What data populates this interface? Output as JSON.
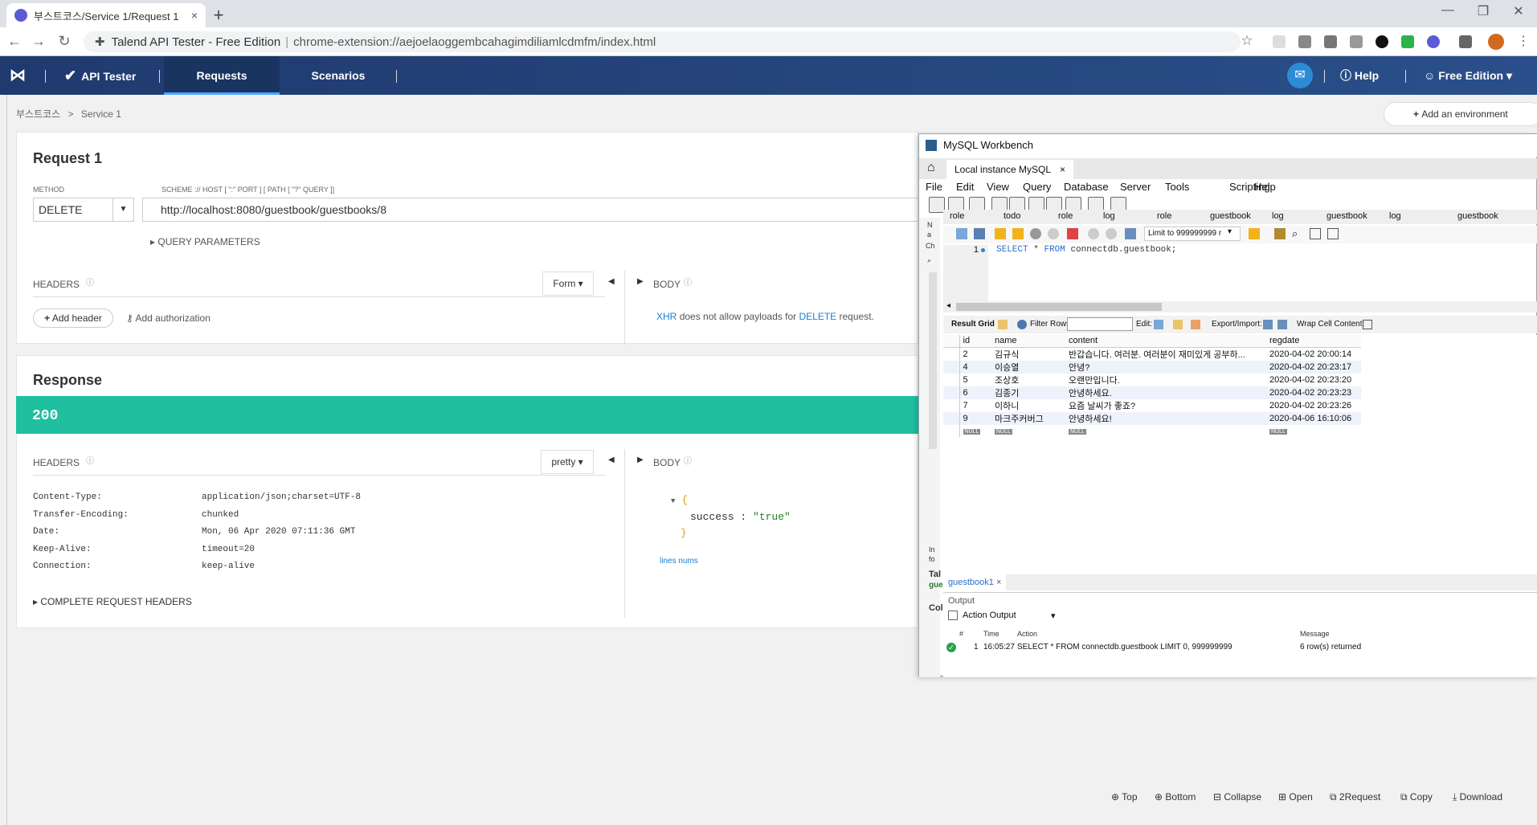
{
  "browser": {
    "tab_title": "부스트코스/Service 1/Request 1",
    "close": "×",
    "newtab": "+",
    "win_min": "—",
    "win_max": "❐",
    "win_close": "✕",
    "back": "←",
    "forward": "→",
    "reload": "↻",
    "ext_title": "Talend API Tester - Free Edition",
    "url": "chrome-extension://aejoelaoggembcahagimdiliamlcdmfm/index.html",
    "star": "☆"
  },
  "app": {
    "brand": "API Tester",
    "tabs": [
      "Requests",
      "Scenarios"
    ],
    "help": "Help",
    "edition": "Free Edition"
  },
  "breadcrumb": {
    "root": "부스트코스",
    "sep": ">",
    "leaf": "Service 1"
  },
  "env_button": "Add an environment",
  "request": {
    "title": "Request 1",
    "method_label": "METHOD",
    "method": "DELETE",
    "scheme_label": "SCHEME :// HOST [ \":\" PORT ] [ PATH [ \"?\" QUERY ]]",
    "url": "http://localhost:8080/guestbook/guestbooks/8",
    "query_params": "QUERY PARAMETERS",
    "headers_label": "HEADERS",
    "form_label": "Form",
    "body_label": "BODY",
    "add_header": "Add header",
    "add_auth": "Add authorization",
    "body_note_xhr": "XHR",
    "body_note_mid": "does not allow payloads for",
    "body_note_method": "DELETE",
    "body_note_end": "request."
  },
  "response": {
    "title": "Response",
    "status": "200",
    "headers_label": "HEADERS",
    "pretty_label": "pretty",
    "body_label": "BODY",
    "headers": [
      {
        "k": "Content-Type:",
        "v": "application/json;charset=UTF-8"
      },
      {
        "k": "Transfer-Encoding:",
        "v": "chunked"
      },
      {
        "k": "Date:",
        "v": "Mon, 06 Apr 2020 07:11:36 GMT"
      },
      {
        "k": "Keep-Alive:",
        "v": "timeout=20"
      },
      {
        "k": "Connection:",
        "v": "keep-alive"
      }
    ],
    "complete_headers": "COMPLETE REQUEST HEADERS",
    "json_open": "{",
    "json_key": "success :",
    "json_val": "\"true\"",
    "json_close": "}",
    "lines_nums": "lines nums"
  },
  "footer": [
    "Top",
    "Bottom",
    "Collapse",
    "Open",
    "2Request",
    "Copy",
    "Download"
  ],
  "workbench": {
    "title": "MySQL Workbench",
    "instance_tab": "Local instance MySQL",
    "menus": [
      "File",
      "Edit",
      "View",
      "Query",
      "Database",
      "Server",
      "Tools",
      "Scripting",
      "Help"
    ],
    "sql_tabs": [
      "role",
      "todo",
      "role",
      "log",
      "role",
      "guestbook",
      "log",
      "guestbook",
      "log",
      "guestbook"
    ],
    "limit": "Limit to 999999999 r",
    "line_no": "1",
    "sql_kw1": "SELECT",
    "sql_star": "*",
    "sql_kw2": "FROM",
    "sql_rest": "connectdb.guestbook;",
    "result_grid": "Result Grid",
    "filter_rows": "Filter Rows:",
    "edit": "Edit:",
    "export": "Export/Import:",
    "wrap": "Wrap Cell Content:",
    "columns": [
      "id",
      "name",
      "content",
      "regdate"
    ],
    "rows": [
      [
        "2",
        "김규식",
        "반갑습니다. 여러분. 여러분이 재미있게 공부하...",
        "2020-04-02 20:00:14"
      ],
      [
        "4",
        "이승열",
        "안녕?",
        "2020-04-02 20:23:17"
      ],
      [
        "5",
        "조상호",
        "오랜만입니다.",
        "2020-04-02 20:23:20"
      ],
      [
        "6",
        "김종기",
        "안녕하세요.",
        "2020-04-02 20:23:23"
      ],
      [
        "7",
        "이하니",
        "요즘 날씨가 좋죠?",
        "2020-04-02 20:23:26"
      ],
      [
        "9",
        "마크주커버그",
        "안녕하세요!",
        "2020-04-06 16:10:06"
      ]
    ],
    "null": "NULL",
    "result_tab": "guestbook1",
    "output": "Output",
    "action_output": "Action Output",
    "out_cols": [
      "#",
      "Time",
      "Action",
      "Message"
    ],
    "out_row": {
      "n": "1",
      "time": "16:05:27",
      "action": "SELECT * FROM connectdb.guestbook LIMIT 0, 999999999",
      "msg": "6 row(s) returned"
    },
    "side_text": [
      "N",
      "a",
      "Ch",
      "In",
      "fo",
      "Tal",
      "gue",
      "Col"
    ]
  },
  "colors": {
    "header_bg": "#1f3a6e",
    "status_green": "#1fbf9f",
    "link": "#1a7fd4",
    "json_key": "#333",
    "json_val": "#2a7d2a"
  }
}
